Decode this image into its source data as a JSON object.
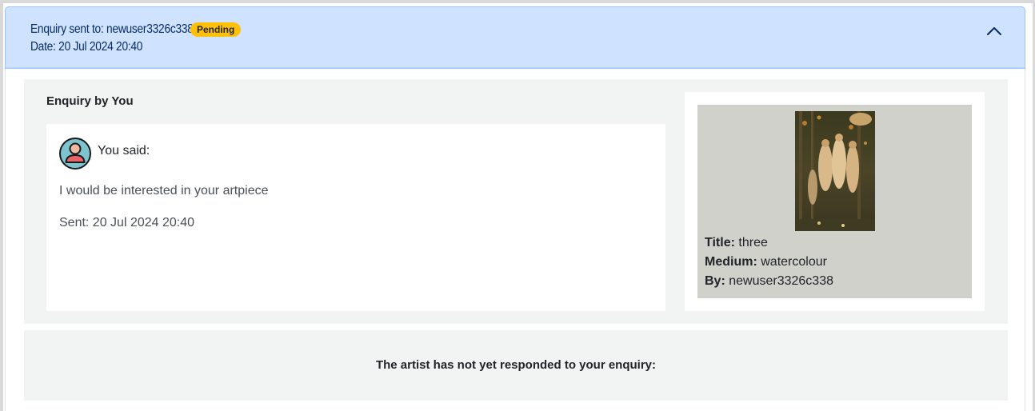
{
  "enquiry": {
    "sent_to_label": "Enquiry sent to:",
    "sent_to_user": "newuser3326c338",
    "status_badge": "Pending",
    "date_label": "Date:",
    "date_value": "20 Jul 2024 20:40"
  },
  "message_section": {
    "title": "Enquiry by You",
    "speaker": "You said:",
    "text": "I would be interested in your artpiece",
    "sent": "Sent: 20 Jul 2024 20:40"
  },
  "artwork": {
    "title_label": "Title:",
    "title_value": "three",
    "medium_label": "Medium:",
    "medium_value": "watercolour",
    "by_label": "By:",
    "by_value": "newuser3326c338"
  },
  "response": {
    "text": "The artist has not yet responded to your enquiry:"
  },
  "icons": {
    "toggle": "chevron-up-icon",
    "avatar": "user-avatar-icon"
  },
  "colors": {
    "header_bg": "#cfe2ff",
    "header_text": "#052c65",
    "badge_bg": "#ffc107",
    "panel_bg": "#f2f4f3",
    "avatar_bg": "#7ec4cf",
    "avatar_body": "#e8636a"
  }
}
